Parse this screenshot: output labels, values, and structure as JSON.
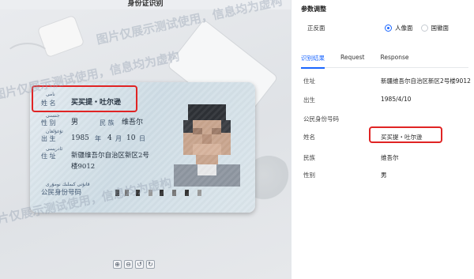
{
  "left_panel": {
    "title": "身份证识别",
    "card": {
      "name_label": "姓 名",
      "name_value": "买买提・吐尔逊",
      "gender_label": "性 别",
      "gender_value": "男",
      "ethnicity_label": "民 族",
      "ethnicity_value": "维吾尔",
      "birth_label": "出 生",
      "birth_year": "1985",
      "year_unit": "年",
      "birth_month": "4",
      "month_unit": "月",
      "birth_day": "10",
      "day_unit": "日",
      "address_label": "住 址",
      "address_line1": "新疆维吾尔自治区新区2号",
      "address_line2": "楼9012",
      "id_label": "公民身份号码",
      "uy_name": "نامى",
      "uy_gender": "جىنسى",
      "uy_birth": "تۇغۇلغان",
      "uy_address": "ئادرېسى",
      "uy_id": "قانۇنى كىملىك نومۇرى"
    },
    "controls": [
      {
        "icon": "zoom-in-icon",
        "glyph": "⊕"
      },
      {
        "icon": "zoom-out-icon",
        "glyph": "⊖"
      },
      {
        "icon": "rotate-left-icon",
        "glyph": "↺"
      },
      {
        "icon": "rotate-right-icon",
        "glyph": "↻"
      }
    ],
    "watermark": "图片仅展示测试使用，信息均为虚构"
  },
  "right_panel": {
    "section_title": "参数调整",
    "param_label": "正反面",
    "radio_options": [
      {
        "label": "人像面",
        "selected": true
      },
      {
        "label": "国徽面",
        "selected": false
      }
    ],
    "tabs": [
      {
        "label": "识别结果",
        "active": true
      },
      {
        "label": "Request",
        "active": false
      },
      {
        "label": "Response",
        "active": false
      }
    ],
    "results": [
      {
        "label": "住址",
        "value": "新疆维吾尔自治区新区2号楼9012"
      },
      {
        "label": "出生",
        "value": "1985/4/10"
      },
      {
        "label": "公民身份号码",
        "value": ""
      },
      {
        "label": "姓名",
        "value": "买买提・吐尔逊"
      },
      {
        "label": "民族",
        "value": "维吾尔"
      },
      {
        "label": "性别",
        "value": "男"
      }
    ]
  },
  "colors": {
    "accent": "#1a66ff",
    "highlight_box": "#e02424"
  }
}
